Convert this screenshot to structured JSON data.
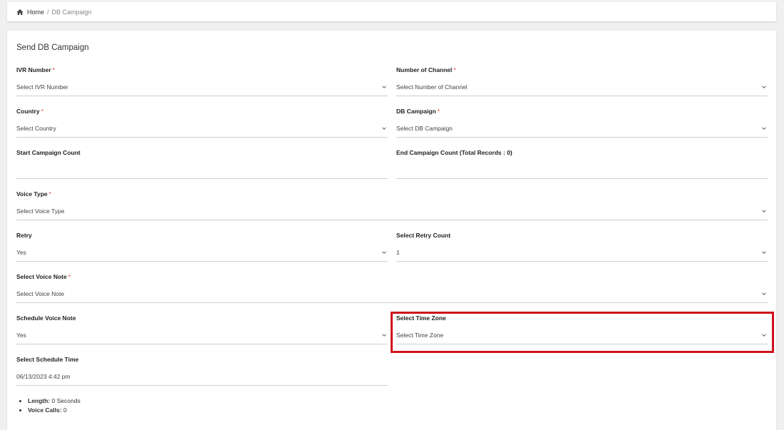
{
  "breadcrumb": {
    "home": "Home",
    "separator": "/",
    "current": "DB Campaign"
  },
  "card": {
    "title": "Send DB Campaign"
  },
  "fields": {
    "ivr_number": {
      "label": "IVR Number",
      "required": "*",
      "placeholder": "Select IVR Number"
    },
    "number_of_channel": {
      "label": "Number of Channel",
      "required": "*",
      "placeholder": "Select Number of Channel"
    },
    "country": {
      "label": "Country",
      "required": "*",
      "placeholder": "Select Country"
    },
    "db_campaign": {
      "label": "DB Campaign",
      "required": "*",
      "placeholder": "Select DB Campaign"
    },
    "start_campaign_count": {
      "label": "Start Campaign Count",
      "value": ""
    },
    "end_campaign_count": {
      "label": "End Campaign Count (Total Records : 0)",
      "value": ""
    },
    "voice_type": {
      "label": "Voice Type",
      "required": "*",
      "placeholder": "Select Voice Type"
    },
    "retry": {
      "label": "Retry",
      "value": "Yes"
    },
    "retry_count": {
      "label": "Select Retry Count",
      "value": "1"
    },
    "voice_note": {
      "label": "Select Voice Note",
      "required": "*",
      "placeholder": "Select Voice Note"
    },
    "schedule_voice_note": {
      "label": "Schedule Voice Note",
      "value": "Yes"
    },
    "time_zone": {
      "label": "Select Time Zone",
      "placeholder": "Select Time Zone"
    },
    "schedule_time": {
      "label": "Select Schedule Time",
      "value": "06/13/2023 4:42 pm"
    }
  },
  "summary": [
    {
      "key": "Length:",
      "value": "0 Seconds"
    },
    {
      "key": "Voice Calls:",
      "value": "0"
    }
  ],
  "colors": {
    "highlight": "#d0121c",
    "required": "#e53935"
  },
  "icons": {
    "home": "home-icon",
    "dropdown": "chevron-down-icon"
  }
}
